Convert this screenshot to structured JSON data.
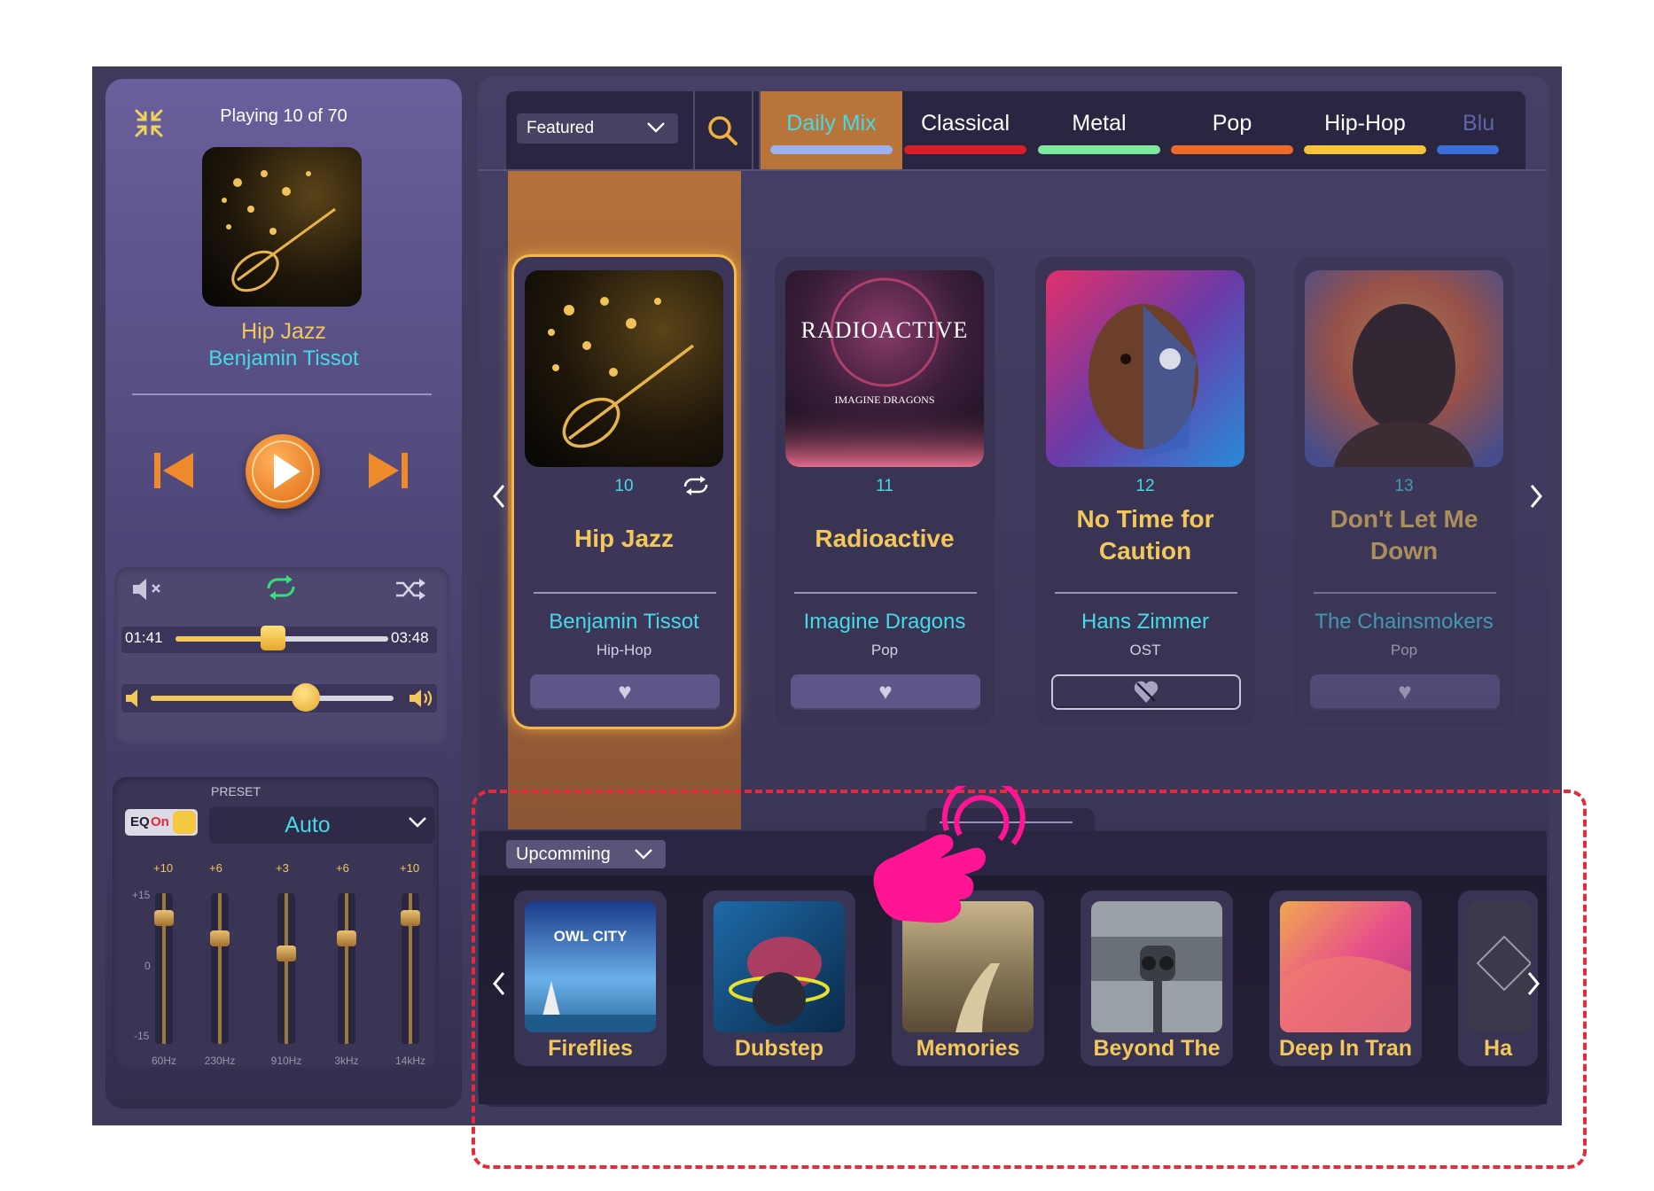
{
  "player": {
    "minimize_icon": "minimize-icon",
    "playing_status": "Playing 10 of 70",
    "now_playing": {
      "title": "Hip Jazz",
      "artist": "Benjamin Tissot"
    },
    "time": {
      "current": "01:41",
      "total": "03:48",
      "progress_fraction": 0.46
    },
    "volume_fraction": 0.64,
    "colors": {
      "accent": "#f3c85a",
      "artist": "#46d9e6",
      "repeat": "#33e07a"
    }
  },
  "equalizer": {
    "preset_label": "PRESET",
    "toggle": {
      "eq": "EQ",
      "state": "On"
    },
    "preset_value": "Auto",
    "scale": {
      "top": "+15",
      "mid": "0",
      "bottom": "-15"
    },
    "bands": [
      {
        "freq": "60Hz",
        "gain": "+10"
      },
      {
        "freq": "230Hz",
        "gain": "+6"
      },
      {
        "freq": "910Hz",
        "gain": "+3"
      },
      {
        "freq": "3kHz",
        "gain": "+6"
      },
      {
        "freq": "14kHz",
        "gain": "+10"
      }
    ]
  },
  "browser": {
    "featured": "Featured",
    "tabs": [
      {
        "label": "Daily Mix",
        "color": "#9fb0ee",
        "text_color": "#46d9e6"
      },
      {
        "label": "Classical",
        "color": "#d71e2a",
        "text_color": "#ffffff"
      },
      {
        "label": "Metal",
        "color": "#7ee89c",
        "text_color": "#ffffff"
      },
      {
        "label": "Pop",
        "color": "#ec6a2a",
        "text_color": "#ffffff"
      },
      {
        "label": "Hip-Hop",
        "color": "#f6c43a",
        "text_color": "#ffffff"
      },
      {
        "label": "Blu",
        "color": "#3a6fd8",
        "text_color": "#5f66a8"
      }
    ],
    "cards": [
      {
        "num": "10",
        "title": "Hip Jazz",
        "artist": "Benjamin Tissot",
        "genre": "Hip-Hop",
        "active": true
      },
      {
        "num": "11",
        "title": "Radioactive",
        "artist": "Imagine Dragons",
        "genre": "Pop"
      },
      {
        "num": "12",
        "title": "No Time for Caution",
        "artist": "Hans Zimmer",
        "genre": "OST"
      },
      {
        "num": "13",
        "title": "Don't Let Me Down",
        "artist": "The Chainsmokers",
        "genre": "Pop"
      }
    ],
    "art_text": {
      "radioactive": "RADIOACTIVE",
      "radioactive_sub": "IMAGINE DRAGONS",
      "owl": "OWL CITY"
    }
  },
  "upcoming": {
    "label": "Upcomming",
    "items": [
      "Fireflies",
      "Dubstep",
      "Memories",
      "Beyond The",
      "Deep In Tran",
      "Ha"
    ]
  }
}
